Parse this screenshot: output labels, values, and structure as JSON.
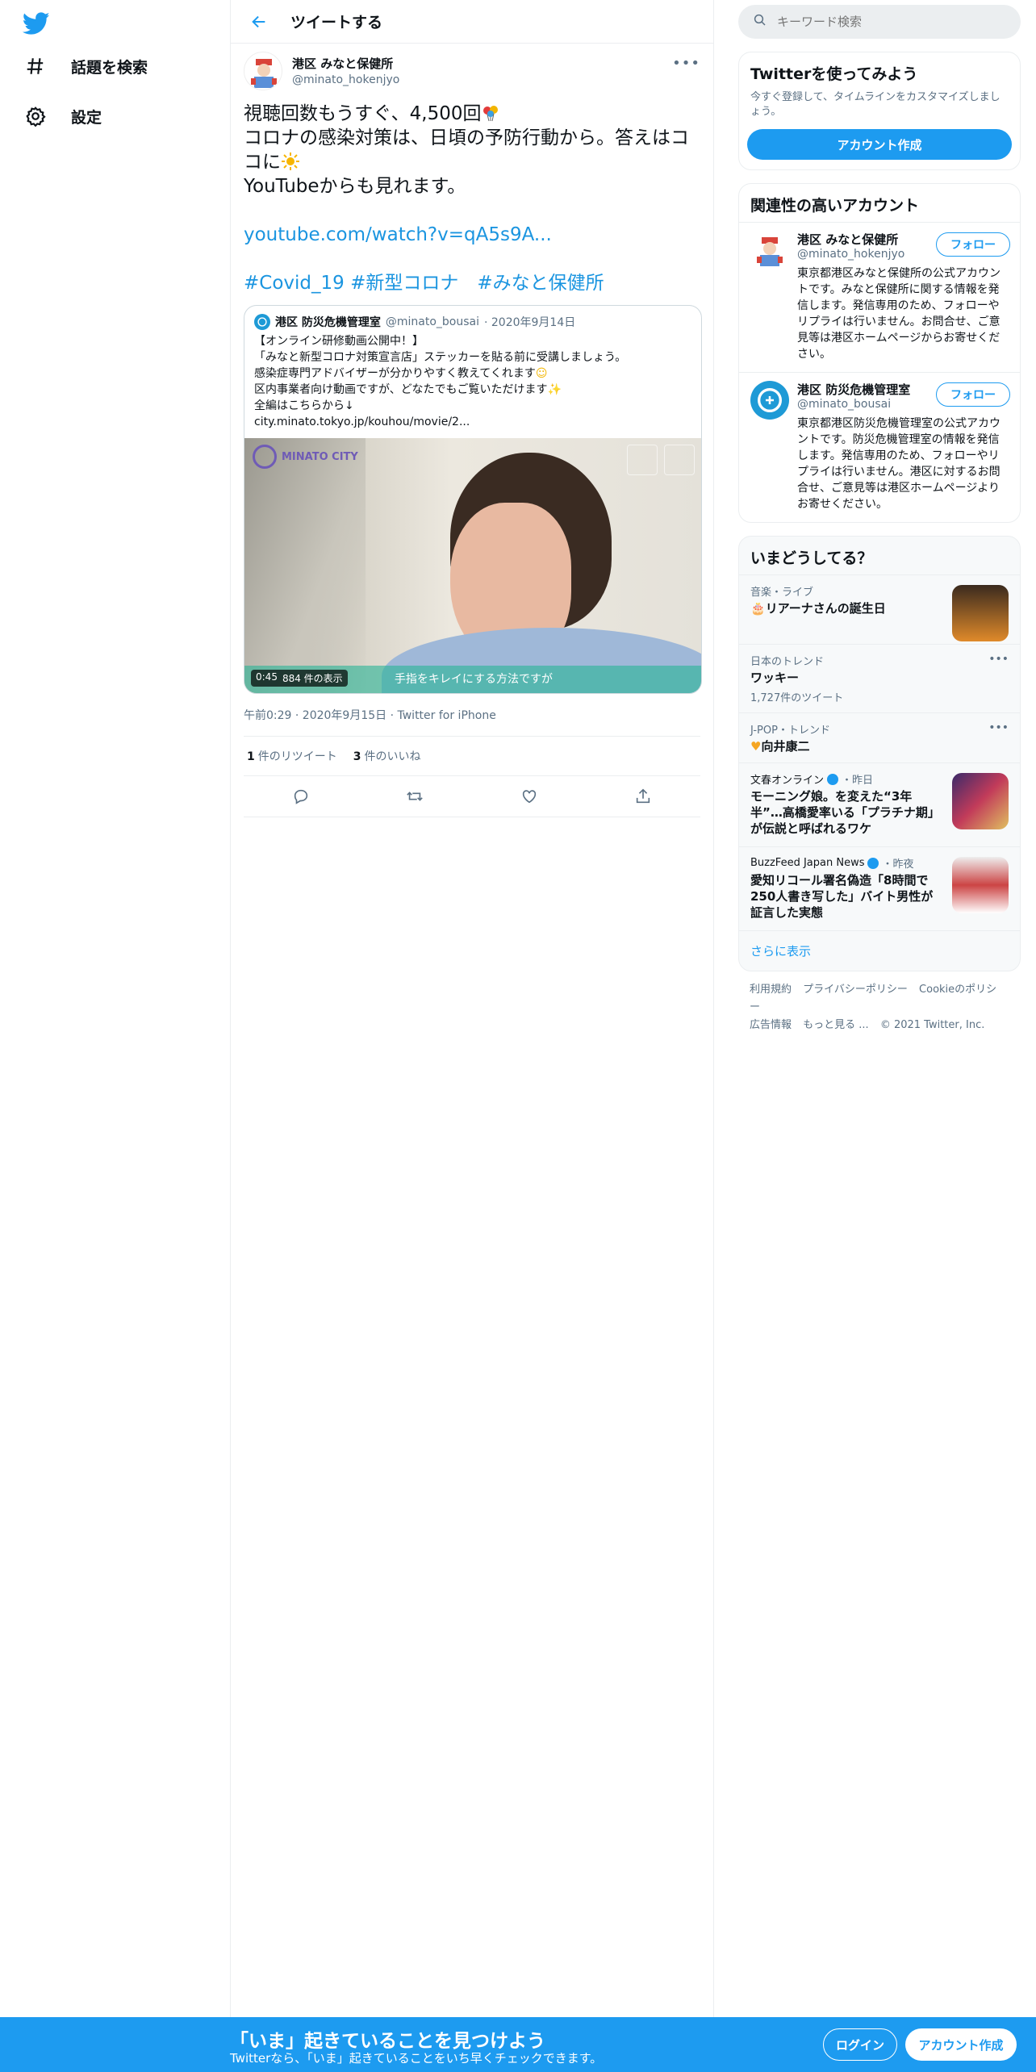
{
  "nav": {
    "items": [
      {
        "label": "話題を検索",
        "icon": "hashtag-icon"
      },
      {
        "label": "設定",
        "icon": "gear-icon"
      }
    ]
  },
  "header": {
    "title": "ツイートする"
  },
  "tweet": {
    "author_name": "港区 みなと保健所",
    "author_handle": "@minato_hokenjyo",
    "text_lines": [
      "視聴回数もうすぐ、4,500回",
      "コロナの感染対策は、日頃の予防行動から。答えはコ",
      "コに",
      "YouTubeからも見れます。"
    ],
    "link": "youtube.com/watch?v=qA5s9A...",
    "hashtags": "#Covid_19 #新型コロナ　#みなと保健所",
    "quote": {
      "name": "港区 防災危機管理室",
      "handle": "@minato_bousai",
      "date": "· 2020年9月14日",
      "lines": [
        "【オンライン研修動画公開中！】",
        "「みなと新型コロナ対策宣言店」ステッカーを貼る前に受講しましょう。",
        "感染症専門アドバイザーが分かりやすく教えてくれます",
        "区内事業者向け動画ですが、どなたでもご覧いただけます",
        "全編はこちらから↓",
        "city.minato.tokyo.jp/kouhou/movie/2..."
      ],
      "video": {
        "brand": "MINATO CITY",
        "duration": "0:45",
        "views": "884 件の表示",
        "caption": "手指をキレイにする方法ですが"
      }
    },
    "meta": "午前0:29 · 2020年9月15日 · Twitter for iPhone",
    "retweets_count": "1",
    "retweets_label": "件のリツイート",
    "likes_count": "3",
    "likes_label": "件のいいね"
  },
  "search": {
    "placeholder": "キーワード検索"
  },
  "signup_panel": {
    "title": "Twitterを使ってみよう",
    "desc": "今すぐ登録して、タイムラインをカスタマイズしましょう。",
    "button": "アカウント作成"
  },
  "related": {
    "title": "関連性の高いアカウント",
    "accounts": [
      {
        "name": "港区 みなと保健所",
        "handle": "@minato_hokenjyo",
        "bio": "東京都港区みなと保健所の公式アカウントです。みなと保健所に関する情報を発信します。発信専用のため、フォローやリプライは行いません。お問合せ、ご意見等は港区ホームページからお寄せください。",
        "follow": "フォロー"
      },
      {
        "name": "港区 防災危機管理室",
        "handle": "@minato_bousai",
        "bio": "東京都港区防災危機管理室の公式アカウントです。防災危機管理室の情報を発信します。発信専用のため、フォローやリプライは行いません。港区に対するお問合せ、ご意見等は港区ホームページよりお寄せください。",
        "follow": "フォロー"
      }
    ]
  },
  "trends": {
    "title": "いまどうしてる？",
    "items": [
      {
        "category": "音楽・ライブ",
        "title": "リアーナさんの誕生日"
      },
      {
        "category": "日本のトレンド",
        "title": "ワッキー",
        "count": "1,727件のツイート"
      },
      {
        "category": "J-POP・トレンド",
        "title": "向井康二"
      },
      {
        "source": "文春オンライン",
        "time": "・昨日",
        "title": "モーニング娘。を変えた“3年半”…高橋愛率いる「プラチナ期」が伝説と呼ばれるワケ"
      },
      {
        "source": "BuzzFeed Japan News",
        "time": "・昨夜",
        "title": "愛知リコール署名偽造「8時間で250人書き写した」バイト男性が証言した実態"
      }
    ],
    "show_more": "さらに表示"
  },
  "footer": {
    "links": [
      "利用規約",
      "プライバシーポリシー",
      "Cookieのポリシー",
      "広告情報",
      "もっと見る ...",
      "© 2021 Twitter, Inc."
    ]
  },
  "bottombar": {
    "title": "「いま」起きていることを見つけよう",
    "subtitle": "Twitterなら、「いま」起きていることをいち早くチェックできます。",
    "login": "ログイン",
    "signup": "アカウント作成"
  },
  "colors": {
    "accent": "#1d9bf0",
    "link": "#1b95e0"
  }
}
